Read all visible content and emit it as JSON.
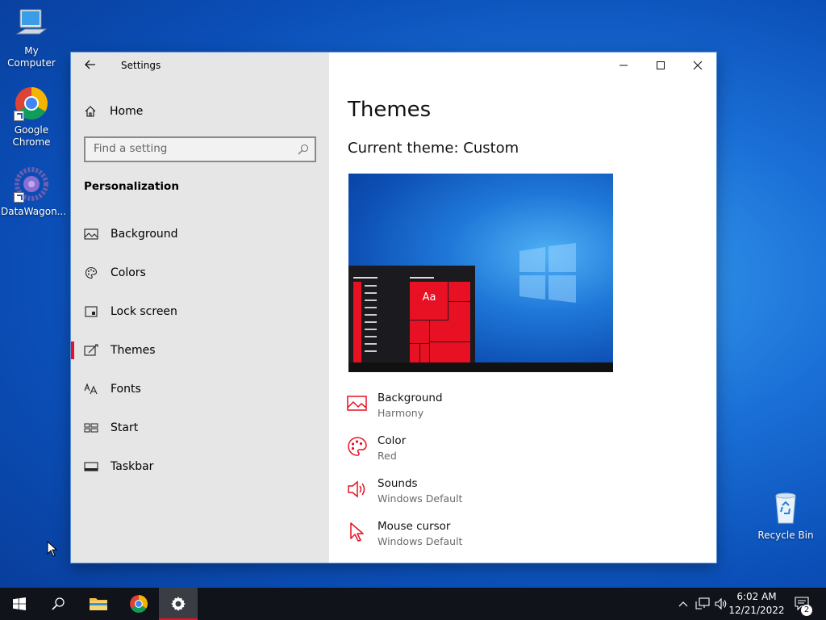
{
  "desktop": {
    "icons": [
      {
        "label": "My Computer"
      },
      {
        "label": "Google Chrome"
      },
      {
        "label": "DataWagon..."
      },
      {
        "label": "Recycle Bin"
      }
    ]
  },
  "window": {
    "title": "Settings",
    "sidebar": {
      "home_label": "Home",
      "search_placeholder": "Find a setting",
      "section": "Personalization",
      "items": [
        {
          "label": "Background",
          "icon": "picture-icon"
        },
        {
          "label": "Colors",
          "icon": "palette-icon"
        },
        {
          "label": "Lock screen",
          "icon": "lock-screen-icon"
        },
        {
          "label": "Themes",
          "icon": "themes-icon",
          "active": true
        },
        {
          "label": "Fonts",
          "icon": "fonts-icon"
        },
        {
          "label": "Start",
          "icon": "start-icon"
        },
        {
          "label": "Taskbar",
          "icon": "taskbar-icon"
        }
      ]
    },
    "content": {
      "title": "Themes",
      "current_theme": "Current theme: Custom",
      "preview_tile_text": "Aa",
      "properties": [
        {
          "name": "Background",
          "value": "Harmony",
          "icon": "picture-icon"
        },
        {
          "name": "Color",
          "value": "Red",
          "icon": "palette-icon"
        },
        {
          "name": "Sounds",
          "value": "Windows Default",
          "icon": "speaker-icon"
        },
        {
          "name": "Mouse cursor",
          "value": "Windows Default",
          "icon": "cursor-icon"
        }
      ]
    }
  },
  "taskbar": {
    "time": "6:02 AM",
    "date": "12/21/2022",
    "notification_count": "2"
  },
  "colors": {
    "accent": "#e81123",
    "sidebar_bg": "#e6e6e6",
    "taskbar_bg": "#10131a"
  }
}
